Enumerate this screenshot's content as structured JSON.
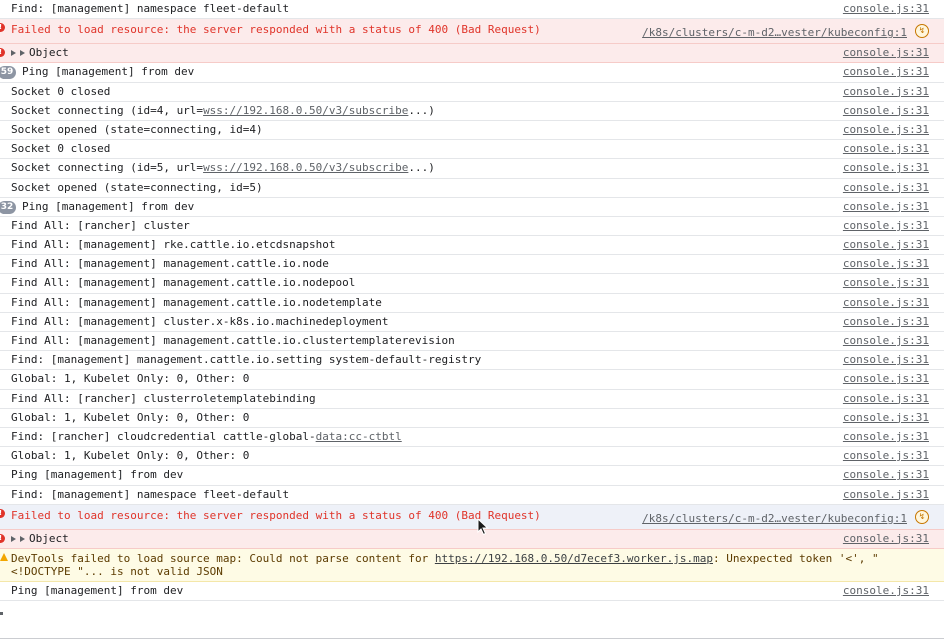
{
  "console": {
    "source": "console.js:31",
    "source_long": "/k8s/clusters/c-m-d2…vester/kubeconfig:1",
    "rows": [
      {
        "type": "log",
        "text": "Find: [management] namespace fleet-default"
      },
      {
        "type": "error",
        "text": "Failed to load resource: the server responded with a status of 400 (Bad Request)"
      },
      {
        "type": "object",
        "text": "Object"
      },
      {
        "type": "log",
        "count": "59",
        "text": "Ping [management] from dev"
      },
      {
        "type": "log",
        "text": "Socket 0 closed"
      },
      {
        "type": "log",
        "pre": "Socket connecting (id=4, url=",
        "link": "wss://192.168.0.50/v3/subscribe",
        "post": "...)"
      },
      {
        "type": "log",
        "text": "Socket opened (state=connecting, id=4)"
      },
      {
        "type": "log",
        "text": "Socket 0 closed"
      },
      {
        "type": "log",
        "pre": "Socket connecting (id=5, url=",
        "link": "wss://192.168.0.50/v3/subscribe",
        "post": "...)"
      },
      {
        "type": "log",
        "text": "Socket opened (state=connecting, id=5)"
      },
      {
        "type": "log",
        "count": "32",
        "text": "Ping [management] from dev"
      },
      {
        "type": "log",
        "text": "Find All: [rancher] cluster"
      },
      {
        "type": "log",
        "text": "Find All: [management] rke.cattle.io.etcdsnapshot"
      },
      {
        "type": "log",
        "text": "Find All: [management] management.cattle.io.node"
      },
      {
        "type": "log",
        "text": "Find All: [management] management.cattle.io.nodepool"
      },
      {
        "type": "log",
        "text": "Find All: [management] management.cattle.io.nodetemplate"
      },
      {
        "type": "log",
        "text": "Find All: [management] cluster.x-k8s.io.machinedeployment"
      },
      {
        "type": "log",
        "text": "Find All: [management] management.cattle.io.clustertemplaterevision"
      },
      {
        "type": "log",
        "text": "Find: [management] management.cattle.io.setting system-default-registry"
      },
      {
        "type": "log",
        "text": "Global: 1, Kubelet Only: 0, Other: 0"
      },
      {
        "type": "log",
        "text": "Find All: [rancher] clusterroletemplatebinding"
      },
      {
        "type": "log",
        "text": "Global: 1, Kubelet Only: 0, Other: 0"
      },
      {
        "type": "log",
        "pre": "Find: [rancher] cloudcredential cattle-global-",
        "link": "data:cc-ctbtl",
        "post": ""
      },
      {
        "type": "log",
        "text": "Global: 1, Kubelet Only: 0, Other: 0"
      },
      {
        "type": "log",
        "text": "Ping [management] from dev"
      },
      {
        "type": "log",
        "text": "Find: [management] namespace fleet-default"
      },
      {
        "type": "error",
        "text": "Failed to load resource: the server responded with a status of 400 (Bad Request)"
      },
      {
        "type": "object",
        "text": "Object"
      },
      {
        "type": "warn",
        "pre": "DevTools failed to load source map: Could not parse content for ",
        "link": "https://192.168.0.50/d7ecef3.worker.js.map",
        "post": ": Unexpected token '<', \"\n<!DOCTYPE \"... is not valid JSON"
      },
      {
        "type": "log",
        "text": "Ping [management] from dev"
      }
    ]
  }
}
